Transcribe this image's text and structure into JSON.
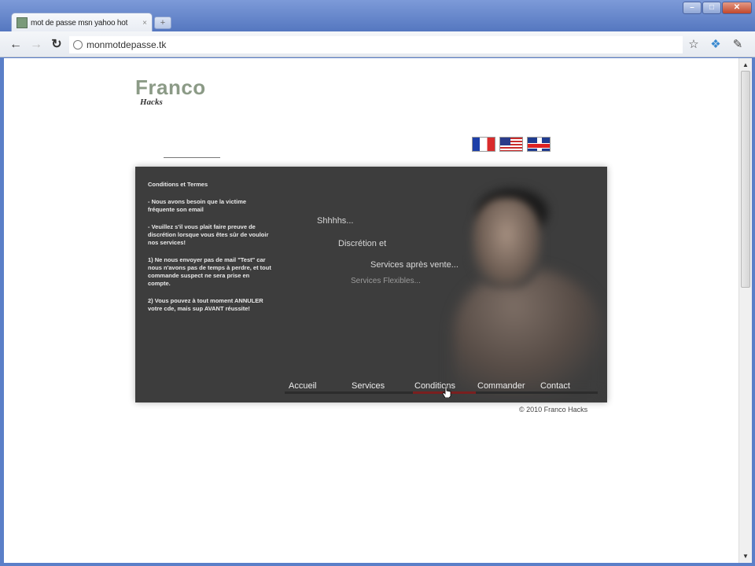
{
  "browser": {
    "tab_title": "mot de passe msn yahoo hot",
    "tab_close": "×",
    "new_tab": "+",
    "url": "monmotdepasse.tk",
    "window_buttons": [
      "–",
      "□",
      "✕"
    ]
  },
  "site": {
    "logo_main": "Franco",
    "logo_sub": "Hacks",
    "flags": [
      "fr-flag",
      "us-flag",
      "uk-flag"
    ],
    "conditions": {
      "title": "Conditions et Termes",
      "paragraphs": [
        "- Nous avons besoin que la victime fréquente son email",
        "- Veuillez s'il vous plait faire preuve de discrétion lorsque vous êtes sûr de vouloir nos services!",
        "1) Ne nous envoyer pas de mail \"Test\" car nous n'avons pas de temps à perdre, et tout commande suspect ne sera prise en compte.",
        "2) Vous pouvez à tout moment ANNULER votre cde, mais sup AVANT réussite!"
      ]
    },
    "slogans": [
      "Shhhhs...",
      "Discrétion et",
      "Services après vente...",
      "Services Flexibles..."
    ],
    "menu": [
      "Accueil",
      "Services",
      "Conditions",
      "Commander",
      "Contact"
    ],
    "active_menu": "Conditions",
    "copyright": "© 2010 Franco Hacks"
  }
}
